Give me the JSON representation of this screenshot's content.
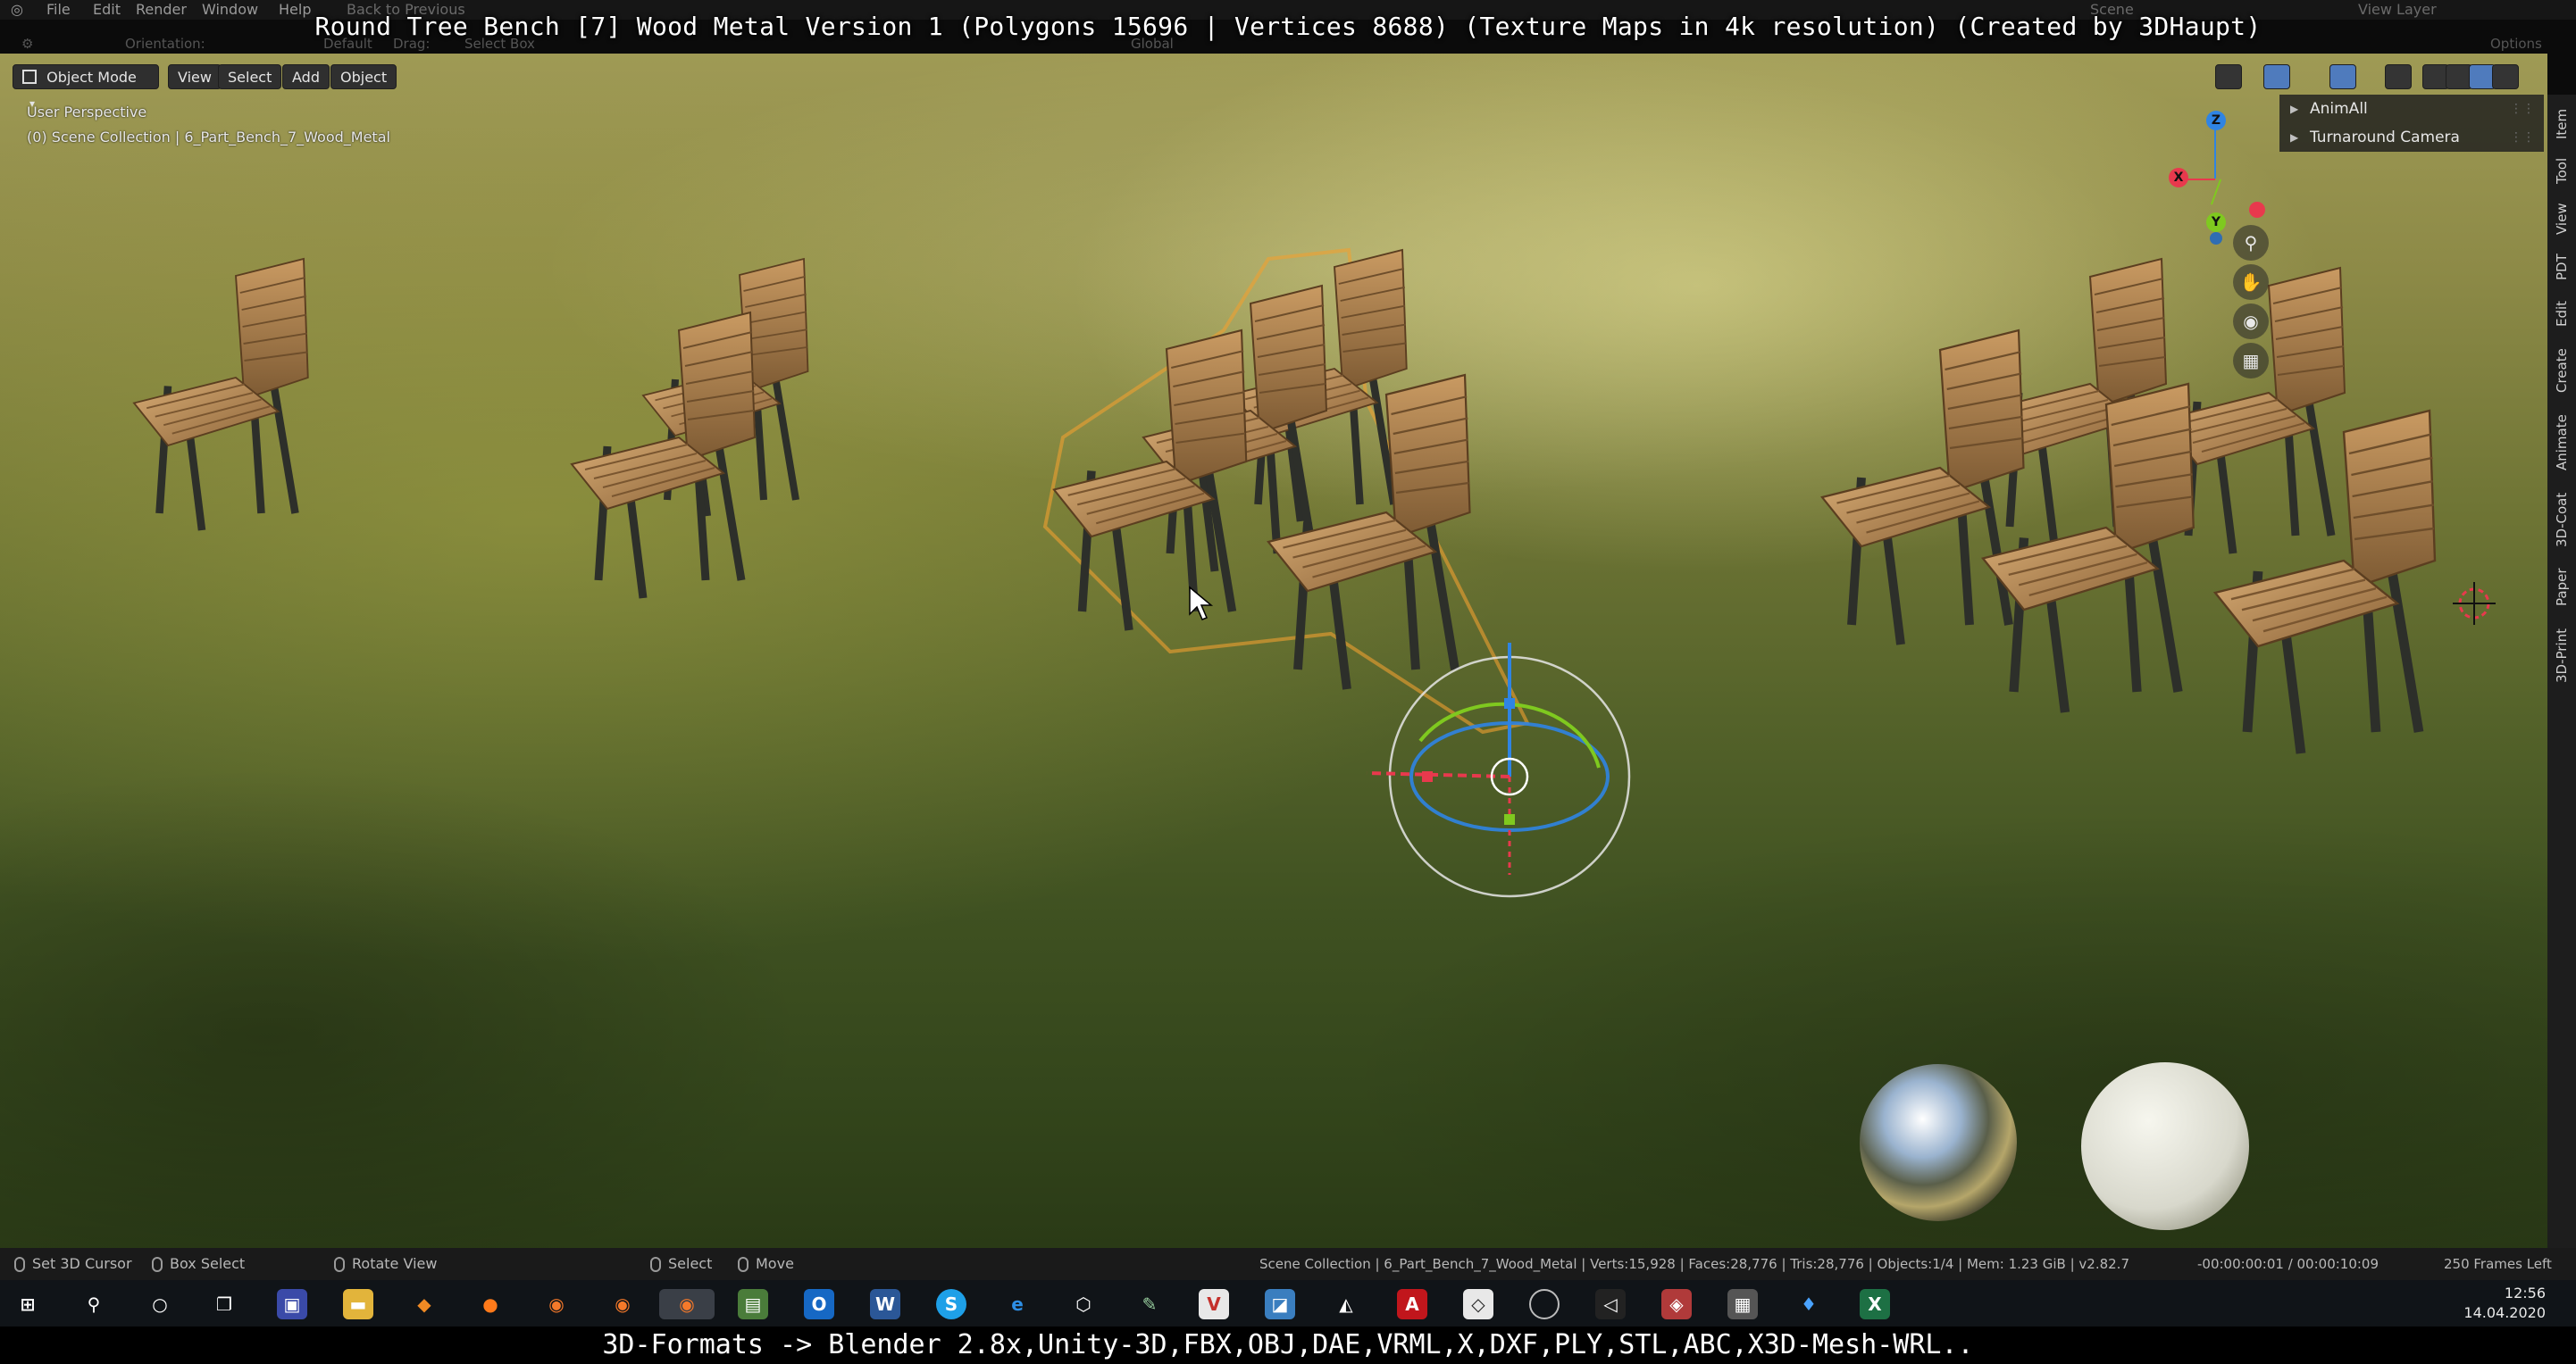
{
  "overlay": {
    "title": "Round Tree Bench [7] Wood Metal Version 1 (Polygons 15696 | Vertices 8688) (Texture Maps in 4k resolution) (Created by 3DHaupt)",
    "caption": "3D-Formats -> Blender 2.8x,Unity-3D,FBX,OBJ,DAE,VRML,X,DXF,PLY,STL,ABC,X3D-Mesh-WRL.."
  },
  "topbar": {
    "menus": [
      "File",
      "Edit",
      "Render",
      "Window",
      "Help"
    ],
    "back_to_previous": "Back to Previous",
    "scene": "Scene",
    "view_layer": "View Layer"
  },
  "tool_header": {
    "orientation_label": "Orientation:",
    "orientation_value": "Default",
    "drag_label": "Drag:",
    "drag_value": "Select Box",
    "transform_value": "Global",
    "options_label": "Options"
  },
  "header": {
    "mode": "Object Mode",
    "menus": [
      "View",
      "Select",
      "Add",
      "Object"
    ]
  },
  "viewport": {
    "perspective": "User Perspective",
    "collection_info": "(0) Scene Collection | 6_Part_Bench_7_Wood_Metal",
    "gizmo_axes": {
      "x": "X",
      "y": "Y",
      "z": "Z"
    }
  },
  "npanel": {
    "items": [
      {
        "label": "AnimAll"
      },
      {
        "label": "Turnaround Camera"
      }
    ]
  },
  "sidebar_tabs": [
    "Item",
    "Tool",
    "View",
    "PDT",
    "Edit",
    "Create",
    "Animate",
    "3D-Coat",
    "Paper",
    "3D-Print"
  ],
  "statusbar": {
    "set_cursor": "Set 3D Cursor",
    "box_select": "Box Select",
    "rotate_view": "Rotate View",
    "select": "Select",
    "move": "Move",
    "scene_stats": "Scene Collection | 6_Part_Bench_7_Wood_Metal | Verts:15,928 | Faces:28,776 | Tris:28,776 | Objects:1/4 | Mem: 1.23 GiB | v2.82.7",
    "timecode": "-00:00:00:01 / 00:00:10:09",
    "frames_left": "250 Frames Left"
  },
  "taskbar": {
    "time": "12:56",
    "date": "14.04.2020",
    "icons": [
      "windows-start",
      "search",
      "cortana",
      "task-view",
      "save",
      "file-explorer",
      "blender-flame",
      "firefox",
      "blender",
      "blender",
      "blender-active",
      "notepad",
      "outlook",
      "word",
      "skype",
      "edge",
      "box-3d",
      "tool",
      "vivaldi",
      "photo",
      "inkscape",
      "acrobat",
      "unity",
      "obs",
      "unity-hub",
      "game",
      "calculator",
      "maps",
      "excel"
    ]
  },
  "colors": {
    "selection_outline": "#f0a030",
    "axis_x": "#e8394d",
    "axis_y": "#7fc91f",
    "axis_z": "#2f84e3",
    "accent": "#4f7bbd"
  }
}
